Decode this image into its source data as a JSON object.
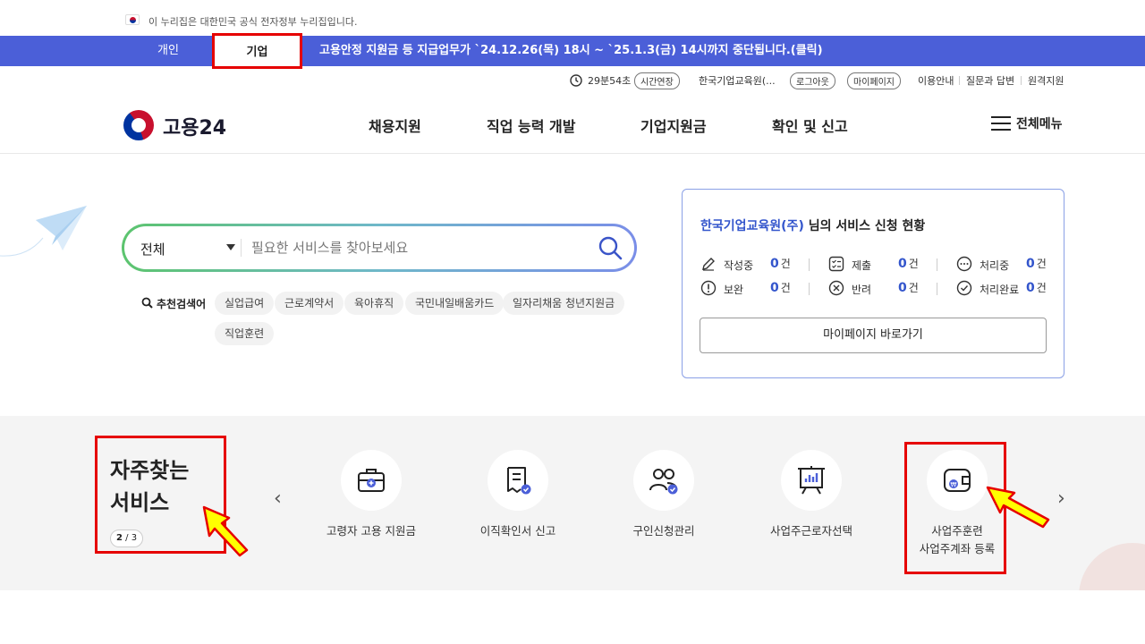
{
  "gov_banner": {
    "text": "이 누리집은 대한민국 공식 전자정부 누리집입니다."
  },
  "topbar": {
    "tabs": [
      "개인",
      "기업"
    ],
    "notice": "고용안정 지원금 등 지급업무가 `24.12.26(목) 18시 ~ `25.1.3(금) 14시까지 중단됩니다.(클릭)"
  },
  "util": {
    "timer": "29분54초",
    "extend": "시간연장",
    "org": "한국기업교육원(...",
    "logout": "로그아웃",
    "mypage": "마이페이지",
    "guide": "이용안내",
    "qna": "질문과 답변",
    "remote": "원격지원"
  },
  "header": {
    "logo": "고용24",
    "nav": [
      "채용지원",
      "직업 능력 개발",
      "기업지원금",
      "확인 및 신고"
    ],
    "allmenu": "전체메뉴"
  },
  "search": {
    "scope": "전체",
    "placeholder": "필요한 서비스를 찾아보세요",
    "rec_label": "추천검색어",
    "keywords": [
      "실업급여",
      "근로계약서",
      "육아휴직",
      "국민내일배움카드",
      "일자리채움 청년지원금",
      "직업훈련"
    ]
  },
  "status": {
    "org": "한국기업교육원(주)",
    "title_suffix": " 님의 서비스 신청 현황",
    "items": [
      {
        "label": "작성중",
        "count": "0",
        "unit": "건",
        "icon": "pencil-icon"
      },
      {
        "label": "제출",
        "count": "0",
        "unit": "건",
        "icon": "checklist-icon"
      },
      {
        "label": "처리중",
        "count": "0",
        "unit": "건",
        "icon": "dots-icon"
      },
      {
        "label": "보완",
        "count": "0",
        "unit": "건",
        "icon": "exclamation-icon"
      },
      {
        "label": "반려",
        "count": "0",
        "unit": "건",
        "icon": "x-circle-icon"
      },
      {
        "label": "처리완료",
        "count": "0",
        "unit": "건",
        "icon": "check-circle-icon"
      }
    ],
    "mypage_btn": "마이페이지 바로가기"
  },
  "freq": {
    "title1": "자주찾는",
    "title2": "서비스",
    "page_current": "2",
    "page_total": "/ 3",
    "services": [
      {
        "label": "고령자 고용 지원금",
        "icon": "briefcase-plus-icon"
      },
      {
        "label": "이직확인서 신고",
        "icon": "document-check-icon"
      },
      {
        "label": "구인신청관리",
        "icon": "people-check-icon"
      },
      {
        "label": "사업주근로자선택",
        "icon": "presentation-board-icon"
      },
      {
        "label": "사업주훈련",
        "label2": "사업주계좌 등록",
        "icon": "wallet-won-icon"
      }
    ]
  },
  "colors": {
    "brand_blue": "#4b5fd8",
    "highlight_red": "#e60000",
    "arrow_yellow": "#ffff00",
    "link_blue": "#3355cc"
  }
}
